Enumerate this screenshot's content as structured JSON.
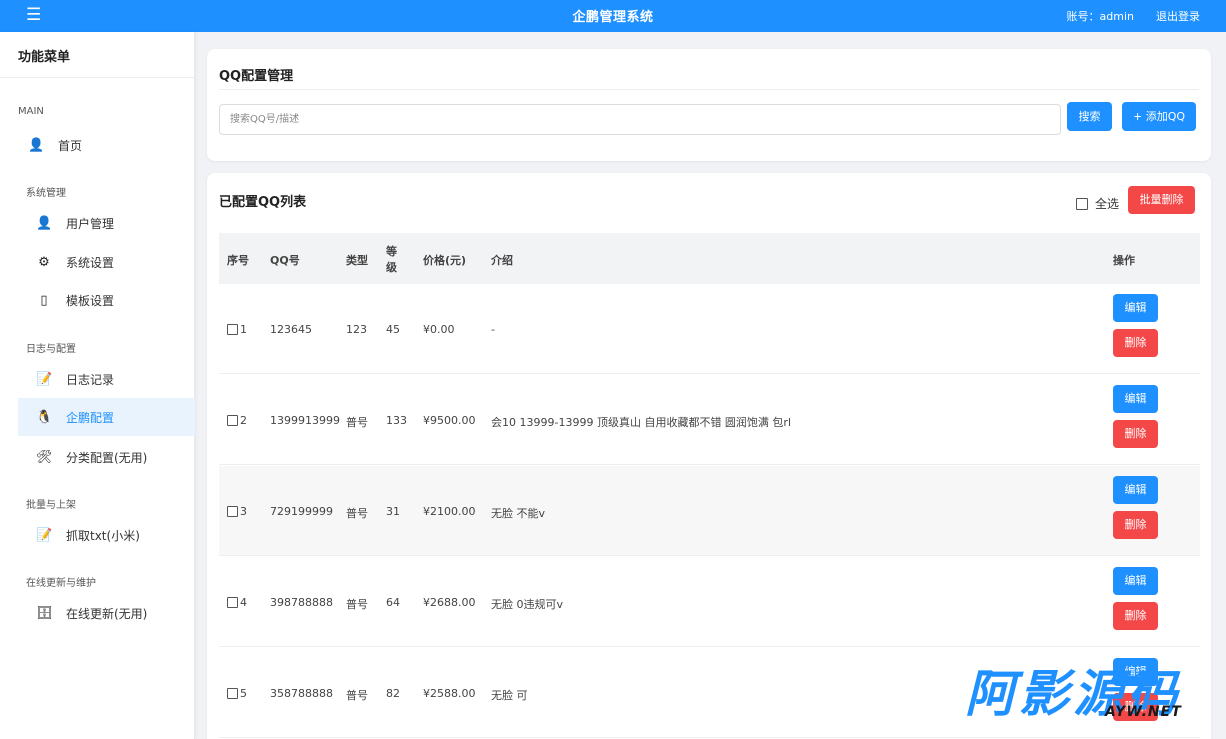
{
  "topbar": {
    "menu_icon": "☰",
    "title": "企鹏管理系统",
    "account": "账号：admin",
    "logout": "退出登录"
  },
  "sidebar": {
    "title": "功能菜单",
    "groups": [
      {
        "label": "MAIN"
      },
      {
        "label": "系统管理"
      },
      {
        "label": "日志与配置"
      },
      {
        "label": "批量与上架"
      },
      {
        "label": "在线更新与维护"
      }
    ],
    "items": [
      {
        "label": "首页",
        "icon": "user-icon",
        "glyph": "👤"
      },
      {
        "label": "用户管理",
        "icon": "user-icon",
        "glyph": "👤"
      },
      {
        "label": "系统设置",
        "icon": "gear-icon",
        "glyph": "⚙"
      },
      {
        "label": "模板设置",
        "icon": "template-icon",
        "glyph": "▯"
      },
      {
        "label": "日志记录",
        "icon": "note-icon",
        "glyph": "📝"
      },
      {
        "label": "企鹏配置",
        "icon": "penguin-icon",
        "glyph": "🐧",
        "active": true
      },
      {
        "label": "分类配置(无用)",
        "icon": "tools-icon",
        "glyph": "🛠"
      },
      {
        "label": "抓取txt(小米)",
        "icon": "note-icon",
        "glyph": "📝"
      },
      {
        "label": "在线更新(无用)",
        "icon": "server-icon",
        "glyph": "🗄"
      }
    ]
  },
  "config_card": {
    "title": "QQ配置管理",
    "search_placeholder": "搜索QQ号/描述",
    "search_button": "搜索",
    "add_button": "+ 添加QQ"
  },
  "list_card": {
    "title": "已配置QQ列表",
    "select_all": "全选",
    "bulk_delete": "批量删除",
    "headers": {
      "index": "序号",
      "qq": "QQ号",
      "type": "类型",
      "level": "等级",
      "price": "价格(元)",
      "desc": "介绍",
      "actions": "操作"
    },
    "edit_label": "编辑",
    "delete_label": "删除",
    "rows": [
      {
        "index": "1",
        "qq": "123645",
        "type": "123",
        "level": "45",
        "price": "¥0.00",
        "desc": "-"
      },
      {
        "index": "2",
        "qq": "1399913999",
        "type": "普号",
        "level": "133",
        "price": "¥9500.00",
        "desc": "会10 13999-13999 顶级真山 自用收藏都不错 圆润饱满 包rl"
      },
      {
        "index": "3",
        "qq": "729199999",
        "type": "普号",
        "level": "31",
        "price": "¥2100.00",
        "desc": "无脸 不能v"
      },
      {
        "index": "4",
        "qq": "398788888",
        "type": "普号",
        "level": "64",
        "price": "¥2688.00",
        "desc": "无脸 0违规可v"
      },
      {
        "index": "5",
        "qq": "358788888",
        "type": "普号",
        "level": "82",
        "price": "¥2588.00",
        "desc": "无脸 可"
      }
    ]
  },
  "watermark": {
    "big": "阿影源码",
    "small": "AYW.NET"
  }
}
